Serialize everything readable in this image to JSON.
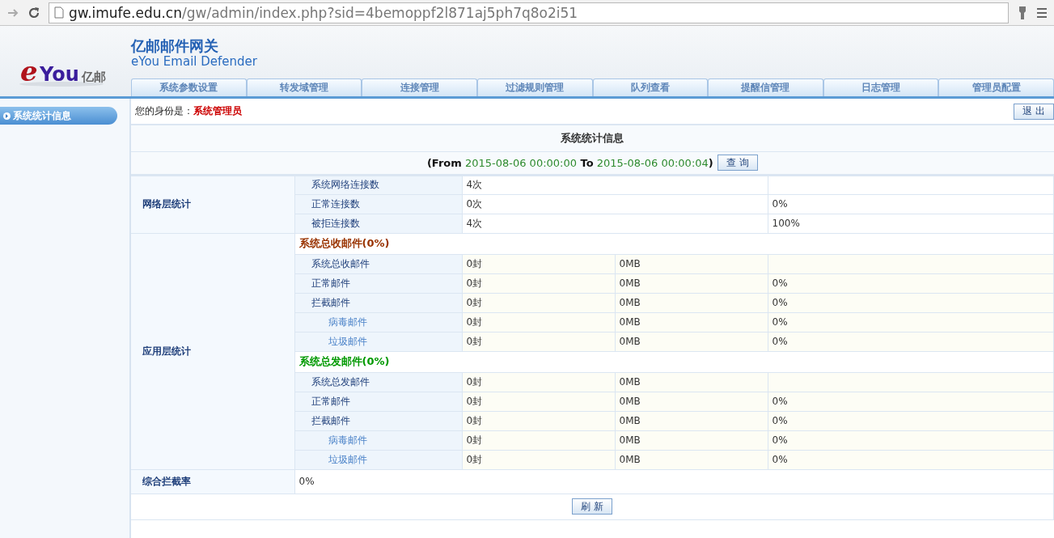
{
  "browser": {
    "url_host": "gw.imufe.edu.cn",
    "url_path": "/gw/admin/index.php?sid=4bemoppf2l871aj5ph7q8o2i51"
  },
  "logo": {
    "mark_e": "e",
    "mark_you": "You",
    "name": "亿邮"
  },
  "header": {
    "title": "亿邮邮件网关",
    "subtitle": "eYou Email Defender"
  },
  "tabs": [
    {
      "label": "系统参数设置"
    },
    {
      "label": "转发域管理"
    },
    {
      "label": "连接管理"
    },
    {
      "label": "过滤规则管理"
    },
    {
      "label": "队列查看"
    },
    {
      "label": "提醒信管理"
    },
    {
      "label": "日志管理"
    },
    {
      "label": "管理员配置"
    }
  ],
  "sidebar": {
    "items": [
      {
        "label": "系统统计信息",
        "selected": true
      }
    ]
  },
  "identity": {
    "label": "您的身份是：",
    "role": "系统管理员"
  },
  "logout_button": "退 出",
  "stats": {
    "title": "系统统计信息",
    "range": [
      {
        "kind": "keyword",
        "text": "(From"
      },
      {
        "kind": "date",
        "text": "2015-08-06 00:00:00"
      },
      {
        "kind": "keyword",
        "text": "To"
      },
      {
        "kind": "date",
        "text": "2015-08-06 00:00:04"
      },
      {
        "kind": "close",
        "text": ")"
      }
    ],
    "query_button": "查 询",
    "network": {
      "label": "网络层统计",
      "rows": [
        {
          "name": "系统网络连接数",
          "count": "4次"
        },
        {
          "name": "正常连接数",
          "count": "0次",
          "percent": "0%"
        },
        {
          "name": "被拒连接数",
          "count": "4次",
          "percent": "100%"
        }
      ]
    },
    "application": {
      "label": "应用层统计",
      "groups": [
        {
          "title": "系统总收邮件(0%)",
          "color": "#993300",
          "rows": [
            {
              "name": "系统总收邮件",
              "count": "0封",
              "size": "0MB"
            },
            {
              "name": "正常邮件",
              "count": "0封",
              "size": "0MB",
              "percent": "0%"
            },
            {
              "name": "拦截邮件",
              "count": "0封",
              "size": "0MB",
              "percent": "0%",
              "children": [
                {
                  "name": "病毒邮件",
                  "count": "0封",
                  "size": "0MB",
                  "percent": "0%"
                },
                {
                  "name": "垃圾邮件",
                  "count": "0封",
                  "size": "0MB",
                  "percent": "0%"
                }
              ]
            }
          ]
        },
        {
          "title": "系统总发邮件(0%)",
          "color": "#009900",
          "rows": [
            {
              "name": "系统总发邮件",
              "count": "0封",
              "size": "0MB"
            },
            {
              "name": "正常邮件",
              "count": "0封",
              "size": "0MB",
              "percent": "0%"
            },
            {
              "name": "拦截邮件",
              "count": "0封",
              "size": "0MB",
              "percent": "0%",
              "children": [
                {
                  "name": "病毒邮件",
                  "count": "0封",
                  "size": "0MB",
                  "percent": "0%"
                },
                {
                  "name": "垃圾邮件",
                  "count": "0封",
                  "size": "0MB",
                  "percent": "0%"
                }
              ]
            }
          ]
        }
      ]
    },
    "overall": {
      "label": "综合拦截率",
      "value": "0%"
    },
    "refresh_button": "刷 新"
  }
}
